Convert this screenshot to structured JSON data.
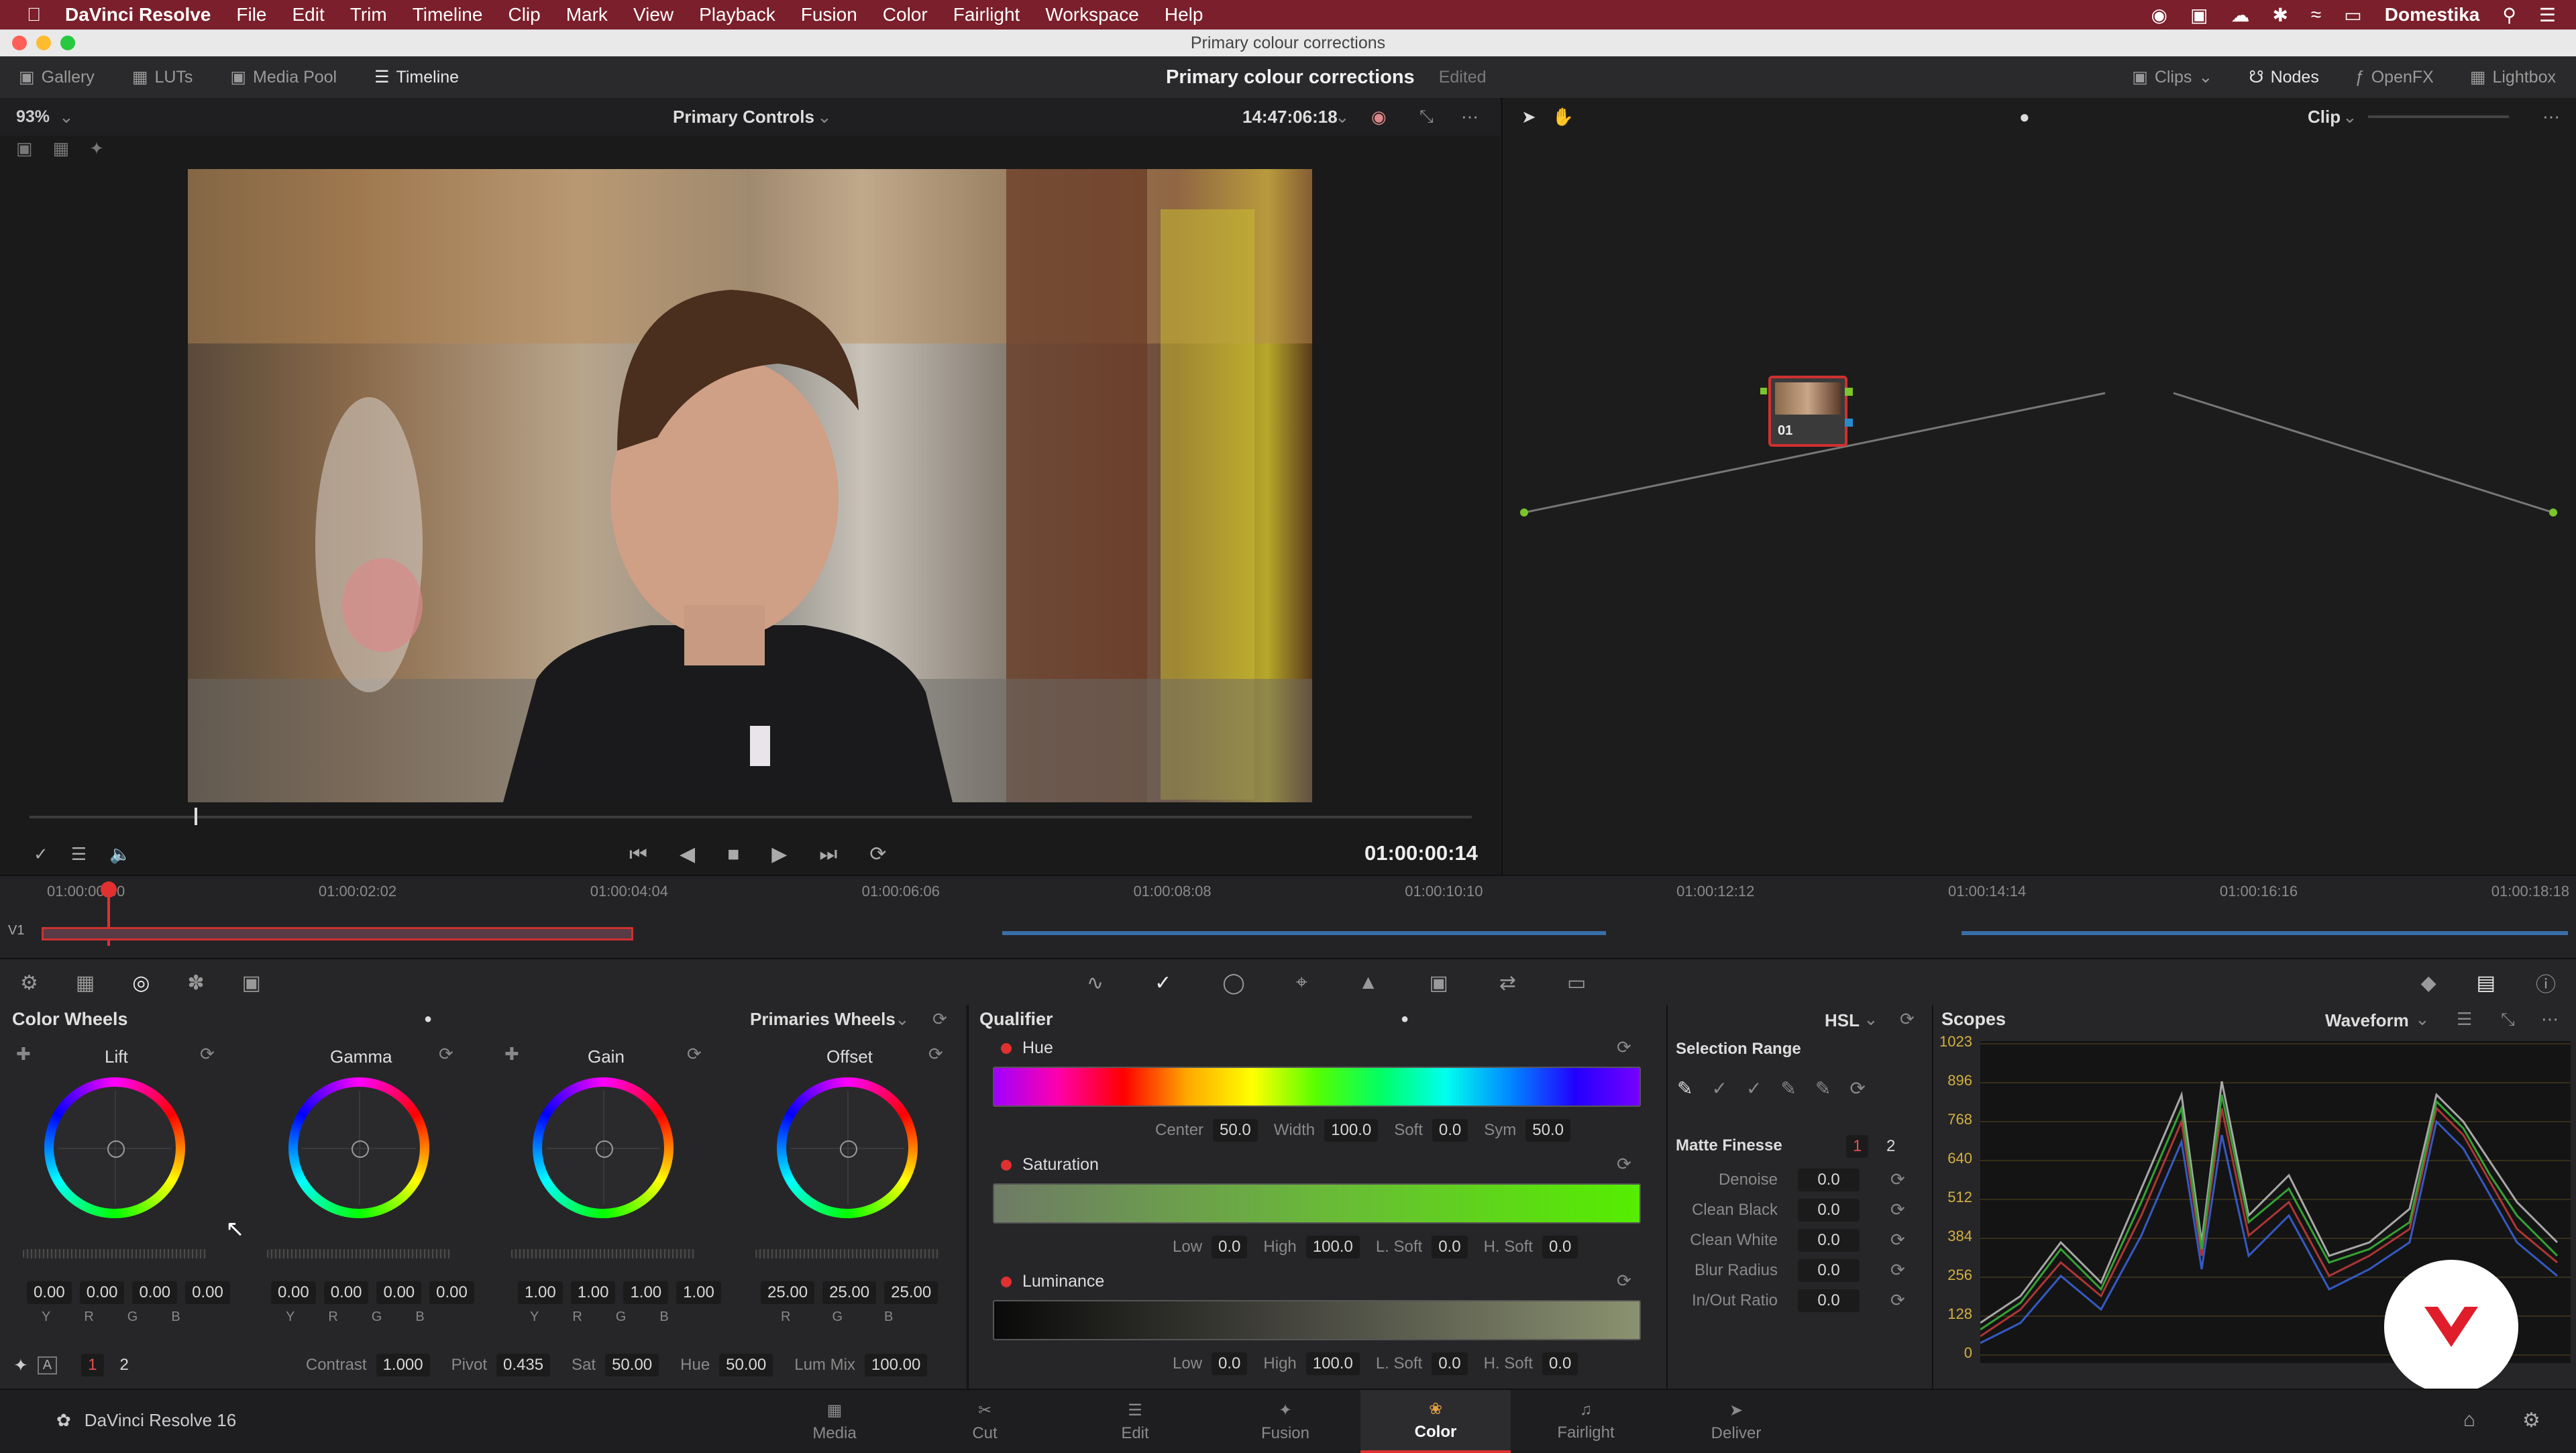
{
  "menubar": {
    "app": "DaVinci Resolve",
    "items": [
      "File",
      "Edit",
      "Trim",
      "Timeline",
      "Clip",
      "Mark",
      "View",
      "Playback",
      "Fusion",
      "Color",
      "Fairlight",
      "Workspace",
      "Help"
    ],
    "user": "Domestika"
  },
  "window": {
    "title": "Primary colour corrections"
  },
  "toolbar": {
    "left": [
      "Gallery",
      "LUTs",
      "Media Pool",
      "Timeline"
    ],
    "project": "Primary colour corrections",
    "status": "Edited",
    "right": [
      "Clips",
      "Nodes",
      "OpenFX",
      "Lightbox"
    ]
  },
  "viewer": {
    "zoom": "93%",
    "mode": "Primary Controls",
    "timecode": "14:47:06:18",
    "playhead_tc": "01:00:00:14"
  },
  "nodes": {
    "mode": "Clip",
    "node_label": "01"
  },
  "timeline": {
    "track": "V1",
    "ruler": [
      "01:00:00:00",
      "01:00:02:02",
      "01:00:04:04",
      "01:00:06:06",
      "01:00:08:08",
      "01:00:10:10",
      "01:00:12:12",
      "01:00:14:14",
      "01:00:16:16",
      "01:00:18:18"
    ]
  },
  "wheels": {
    "title": "Color Wheels",
    "mode": "Primaries Wheels",
    "items": [
      {
        "name": "Lift",
        "values": [
          "0.00",
          "0.00",
          "0.00",
          "0.00"
        ],
        "channels": [
          "Y",
          "R",
          "G",
          "B"
        ]
      },
      {
        "name": "Gamma",
        "values": [
          "0.00",
          "0.00",
          "0.00",
          "0.00"
        ],
        "channels": [
          "Y",
          "R",
          "G",
          "B"
        ]
      },
      {
        "name": "Gain",
        "values": [
          "1.00",
          "1.00",
          "1.00",
          "1.00"
        ],
        "channels": [
          "Y",
          "R",
          "G",
          "B"
        ]
      },
      {
        "name": "Offset",
        "values": [
          "25.00",
          "25.00",
          "25.00"
        ],
        "channels": [
          "R",
          "G",
          "B"
        ]
      }
    ],
    "bottom": {
      "page1": "1",
      "page2": "2",
      "contrast_label": "Contrast",
      "contrast": "1.000",
      "pivot_label": "Pivot",
      "pivot": "0.435",
      "sat_label": "Sat",
      "sat": "50.00",
      "hue_label": "Hue",
      "hue": "50.00",
      "lummix_label": "Lum Mix",
      "lummix": "100.00"
    }
  },
  "qualifier": {
    "title": "Qualifier",
    "mode": "HSL",
    "hue": {
      "label": "Hue",
      "center_label": "Center",
      "center": "50.0",
      "width_label": "Width",
      "width": "100.0",
      "soft_label": "Soft",
      "soft": "0.0",
      "sym_label": "Sym",
      "sym": "50.0"
    },
    "saturation": {
      "label": "Saturation",
      "low_label": "Low",
      "low": "0.0",
      "high_label": "High",
      "high": "100.0",
      "lsoft_label": "L. Soft",
      "lsoft": "0.0",
      "hsoft_label": "H. Soft",
      "hsoft": "0.0"
    },
    "luminance": {
      "label": "Luminance",
      "low_label": "Low",
      "low": "0.0",
      "high_label": "High",
      "high": "100.0",
      "lsoft_label": "L. Soft",
      "lsoft": "0.0",
      "hsoft_label": "H. Soft",
      "hsoft": "0.0"
    }
  },
  "selection": {
    "title": "Selection Range",
    "matte": "Matte Finesse",
    "p1": "1",
    "p2": "2",
    "rows": [
      {
        "label": "Denoise",
        "value": "0.0"
      },
      {
        "label": "Clean Black",
        "value": "0.0"
      },
      {
        "label": "Clean White",
        "value": "0.0"
      },
      {
        "label": "Blur Radius",
        "value": "0.0"
      },
      {
        "label": "In/Out Ratio",
        "value": "0.0"
      }
    ]
  },
  "scopes": {
    "title": "Scopes",
    "mode": "Waveform",
    "ticks": [
      "1023",
      "896",
      "768",
      "640",
      "512",
      "384",
      "256",
      "128",
      "0"
    ]
  },
  "pagebar": {
    "app": "DaVinci Resolve 16",
    "pages": [
      "Media",
      "Cut",
      "Edit",
      "Fusion",
      "Color",
      "Fairlight",
      "Deliver"
    ],
    "active": "Color"
  }
}
